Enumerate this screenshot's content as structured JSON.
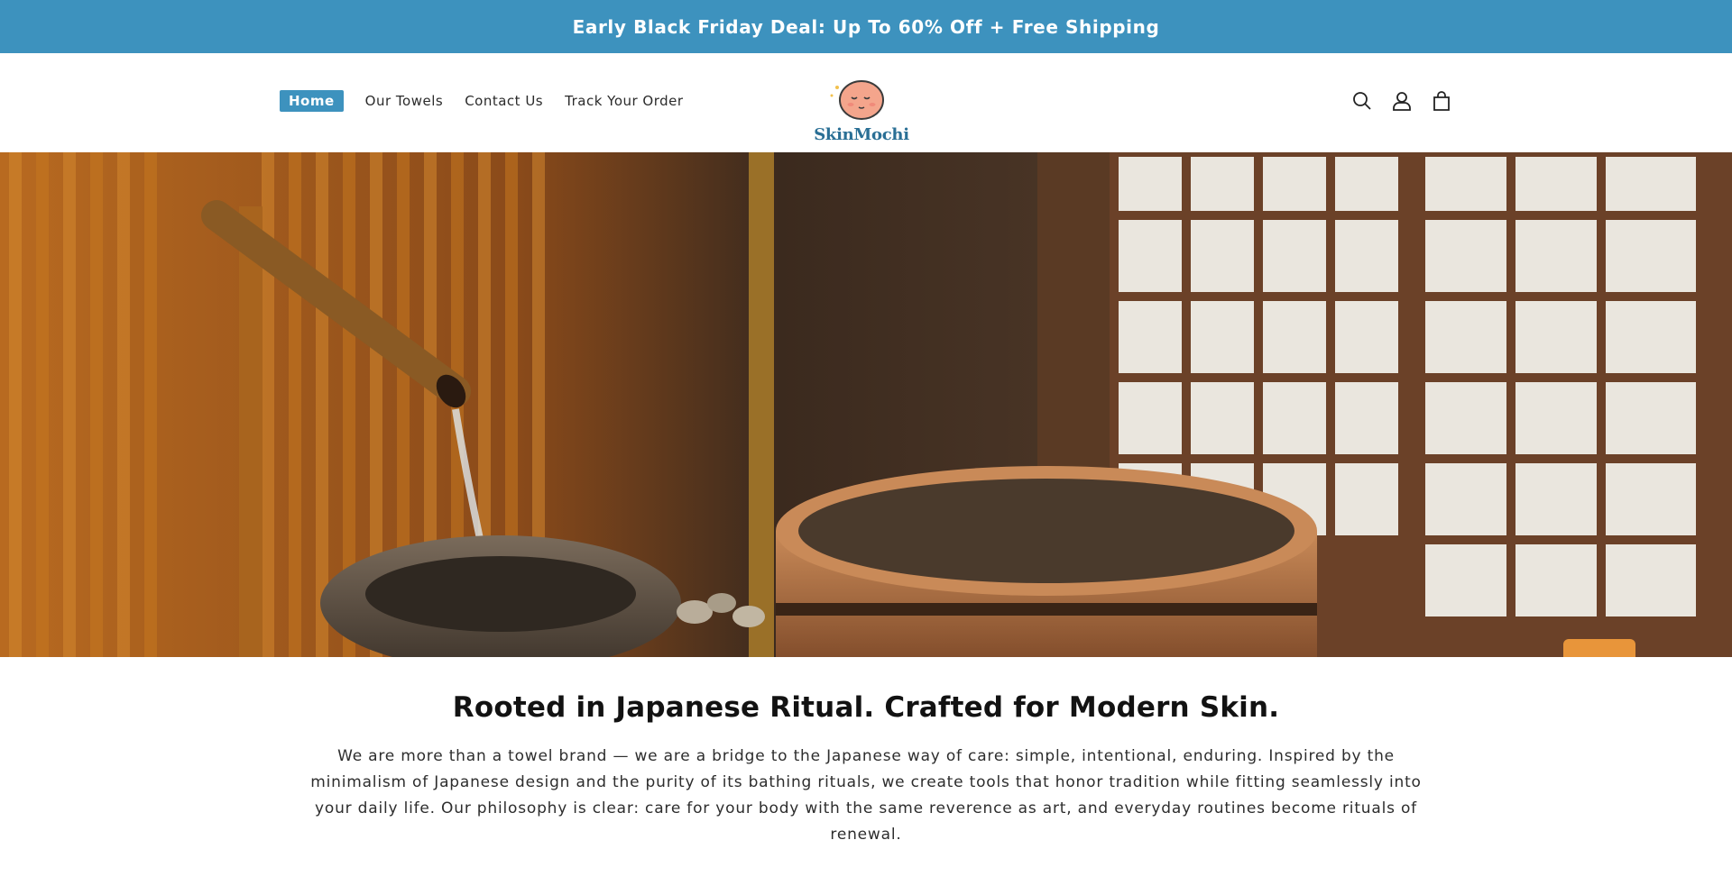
{
  "announcement": {
    "text": "Early Black Friday Deal: Up To 60% Off + Free Shipping"
  },
  "nav": {
    "items": [
      {
        "label": "Home",
        "active": true
      },
      {
        "label": "Our Towels",
        "active": false
      },
      {
        "label": "Contact Us",
        "active": false
      },
      {
        "label": "Track Your Order",
        "active": false
      }
    ]
  },
  "brand": {
    "name": "SkinMochi"
  },
  "header_icons": [
    "search-icon",
    "account-icon",
    "cart-icon"
  ],
  "hero": {
    "alt": "Japanese bath with bamboo water spout, stone basin and wooden tub"
  },
  "story": {
    "heading": "Rooted in Japanese Ritual. Crafted for Modern Skin.",
    "body": "We are more than a towel brand — we are a bridge to the Japanese way of care: simple, intentional, enduring. Inspired by the minimalism of Japanese design and the purity of its bathing rituals, we create tools that honor tradition while fitting seamlessly into your daily life. Our philosophy is clear: care for your body with the same reverence as art, and everyday routines become rituals of renewal."
  },
  "colors": {
    "accent": "#3d92be",
    "brand_text": "#2a6f95"
  }
}
